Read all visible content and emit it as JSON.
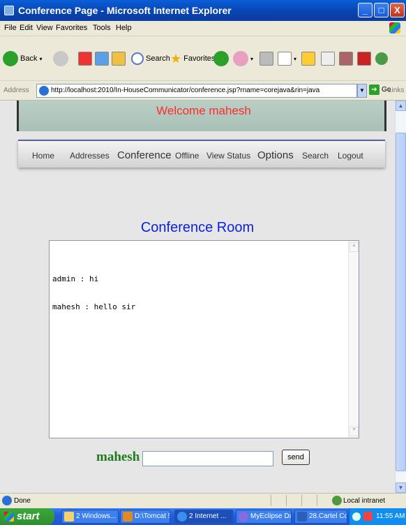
{
  "window": {
    "title": "Conference Page - Microsoft Internet Explorer",
    "minimize": "_",
    "maximize": "□",
    "close": "X"
  },
  "menu": [
    "File",
    "Edit",
    "View",
    "Favorites",
    "Tools",
    "Help"
  ],
  "toolbar": {
    "back": "Back",
    "search": "Search",
    "favorites": "Favorites"
  },
  "address": {
    "label": "Address",
    "url": "http://localhost:2010/In-HouseCommunicator/conference.jsp?rname=corejava&rin=java",
    "go": "Go",
    "links": "Links"
  },
  "page": {
    "welcome": "Welcome mahesh",
    "nav": [
      "Home",
      "Addresses",
      "Conference",
      "Offline",
      "View Status",
      "Options",
      "Search",
      "Logout"
    ],
    "room_title": "Conference Room",
    "messages": [
      "admin : hi",
      "mahesh : hello sir"
    ],
    "message_user": "mahesh",
    "message_colon": ":",
    "message_value": "",
    "send_label": "send"
  },
  "status": {
    "text": "Done",
    "zone": "Local intranet"
  },
  "taskbar": {
    "start": "start",
    "tasks": [
      "2 Windows...",
      "D:\\Tomcat 5...",
      "2 Internet ...",
      "MyEclipse Da...",
      "28.Cartel Co..."
    ],
    "clock": "11:55 AM"
  },
  "colors": {
    "welcome": "#ff2a2a",
    "room_title": "#0a1fe6",
    "user_name": "#1d7a1d"
  }
}
